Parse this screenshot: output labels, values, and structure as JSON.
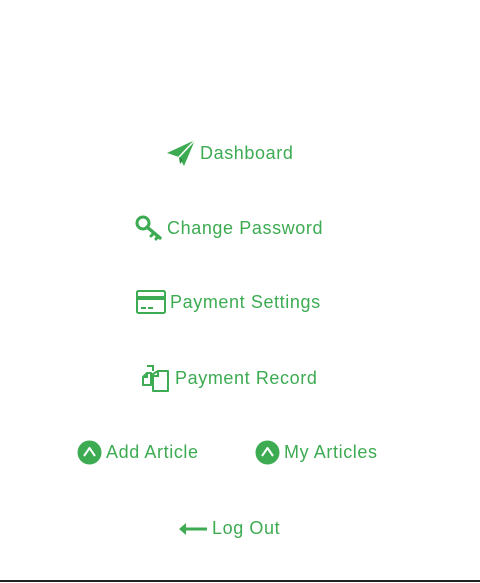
{
  "theme": {
    "accent": "#3cab52",
    "divider": "#222222"
  },
  "menu": {
    "dashboard": {
      "label": "Dashboard",
      "icon": "paper-plane-icon"
    },
    "change_password": {
      "label": "Change Password",
      "icon": "key-icon"
    },
    "payment_settings": {
      "label": "Payment Settings",
      "icon": "credit-card-icon"
    },
    "payment_record": {
      "label": "Payment Record",
      "icon": "copy-documents-icon"
    },
    "add_article": {
      "label": "Add Article",
      "icon": "circle-up-caret-icon"
    },
    "my_articles": {
      "label": "My Articles",
      "icon": "circle-up-caret-icon"
    },
    "log_out": {
      "label": "Log Out",
      "icon": "arrow-left-icon"
    }
  }
}
